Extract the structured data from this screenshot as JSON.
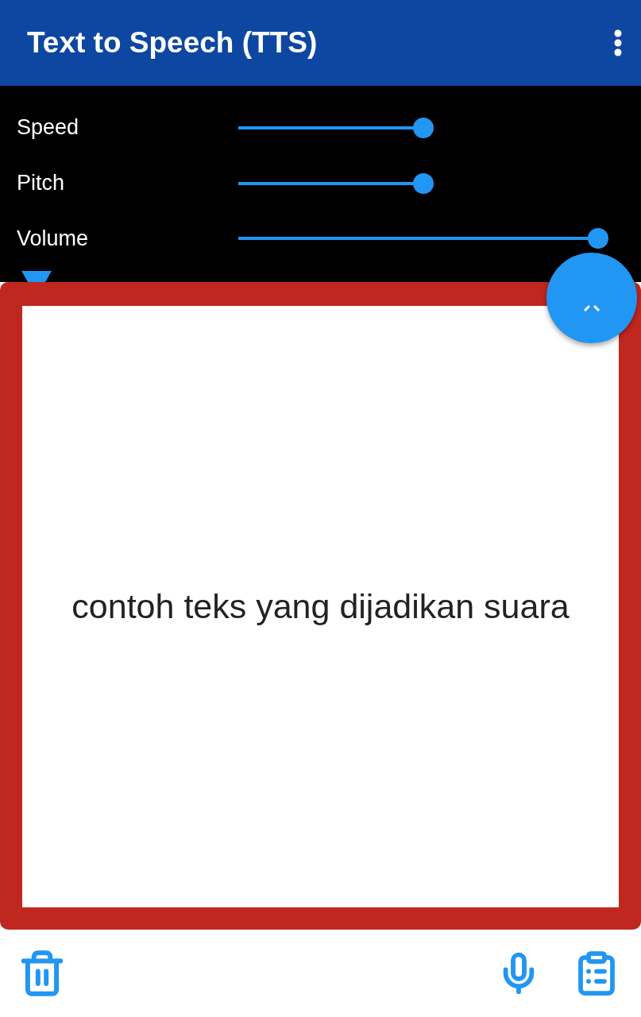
{
  "app_bar": {
    "title": "Text to Speech (TTS)"
  },
  "sliders": [
    {
      "label": "Speed",
      "level": 0.5
    },
    {
      "label": "Pitch",
      "level": 0.5
    },
    {
      "label": "Volume",
      "level": 1
    }
  ],
  "text_area": {
    "value": "contoh teks yang dijadikan suara"
  }
}
